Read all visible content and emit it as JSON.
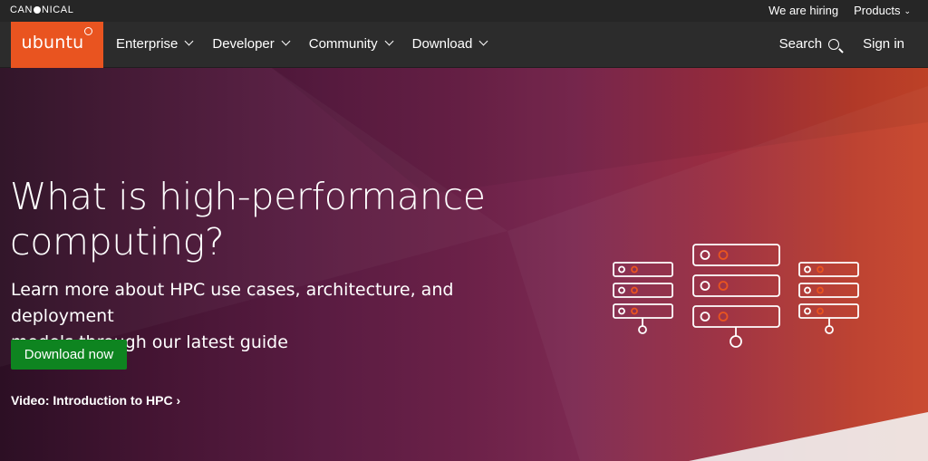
{
  "topbar": {
    "logo_text": [
      "CAN",
      "NICAL"
    ],
    "hiring_link": "We are hiring",
    "products_menu": "Products"
  },
  "nav": {
    "brand": "ubuntu",
    "items": [
      {
        "label": "Enterprise"
      },
      {
        "label": "Developer"
      },
      {
        "label": "Community"
      },
      {
        "label": "Download"
      }
    ],
    "search_label": "Search",
    "signin_label": "Sign in"
  },
  "hero": {
    "title_line1": "What is high-performance",
    "title_line2": "computing?",
    "subtitle_line1": "Learn more about HPC use cases, architecture, and deployment",
    "subtitle_line2": "models through our latest guide",
    "cta_label": "Download now",
    "video_link": "Video: Introduction to HPC ›"
  },
  "colors": {
    "brand_orange": "#e95420",
    "cta_green": "#0e8420",
    "nav_bg": "#2c2c2c",
    "topbar_bg": "#262626",
    "illustration_accent": "#e95420"
  },
  "icons": {
    "search": "search-icon",
    "chevron": "chevron-down-icon",
    "illustration": "server-racks-icon"
  }
}
